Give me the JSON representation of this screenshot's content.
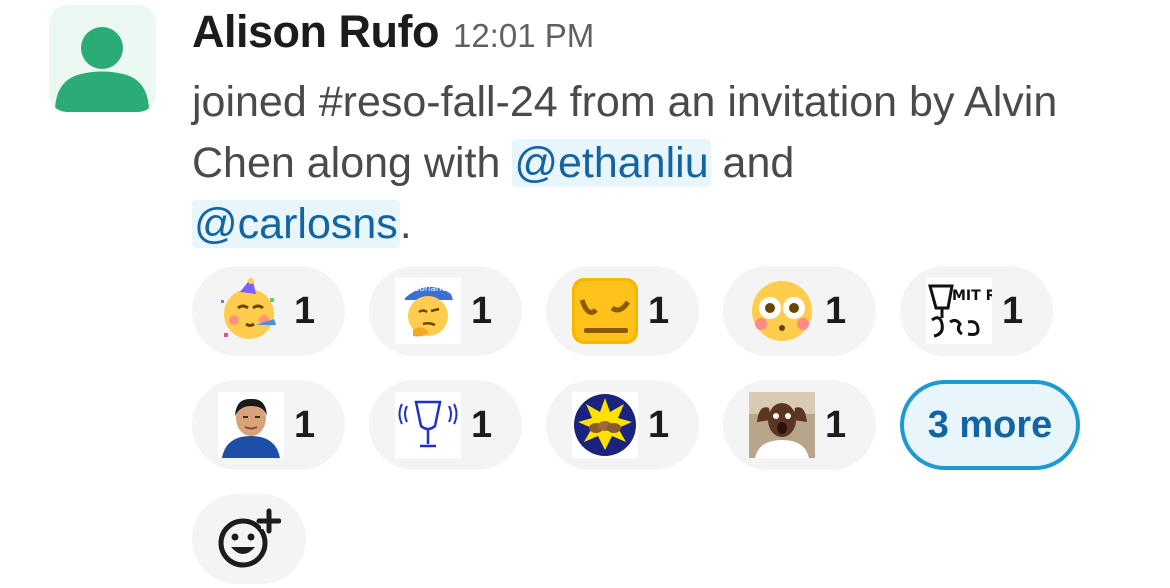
{
  "message": {
    "author": "Alison Rufo",
    "timestamp": "12:01 PM",
    "text_parts": {
      "p1": "joined #reso-fall-24 from an invitation by Alvin Chen along with ",
      "mention1": "@ethanliu",
      "p2": " and ",
      "mention2": "@carlosns",
      "p3": "."
    },
    "avatar_icon": "default-user-avatar-icon"
  },
  "reactions": [
    {
      "emoji": "partying-face-emoji",
      "count": "1"
    },
    {
      "emoji": "rizzonance-custom-emoji",
      "count": "1",
      "emoji_text": "rizzonance"
    },
    {
      "emoji": "unamused-square-face-emoji",
      "count": "1"
    },
    {
      "emoji": "flushed-face-emoji",
      "count": "1"
    },
    {
      "emoji": "mit-reso-logo-custom-emoji",
      "count": "1",
      "emoji_text": "MIT RESO"
    },
    {
      "emoji": "person-photo-custom-emoji",
      "count": "1"
    },
    {
      "emoji": "wine-glass-sketch-custom-emoji",
      "count": "1"
    },
    {
      "emoji": "sunburst-badge-custom-emoji",
      "count": "1"
    },
    {
      "emoji": "shocked-person-photo-custom-emoji",
      "count": "1"
    }
  ],
  "more_reactions_label": "3 more",
  "add_reaction_icon": "add-emoji-icon",
  "colors": {
    "mention_text": "#1264a3",
    "mention_bg": "#e8f5fa",
    "more_border": "#1d9bd1",
    "pill_bg": "#f4f4f4",
    "avatar_green": "#2bac76"
  }
}
